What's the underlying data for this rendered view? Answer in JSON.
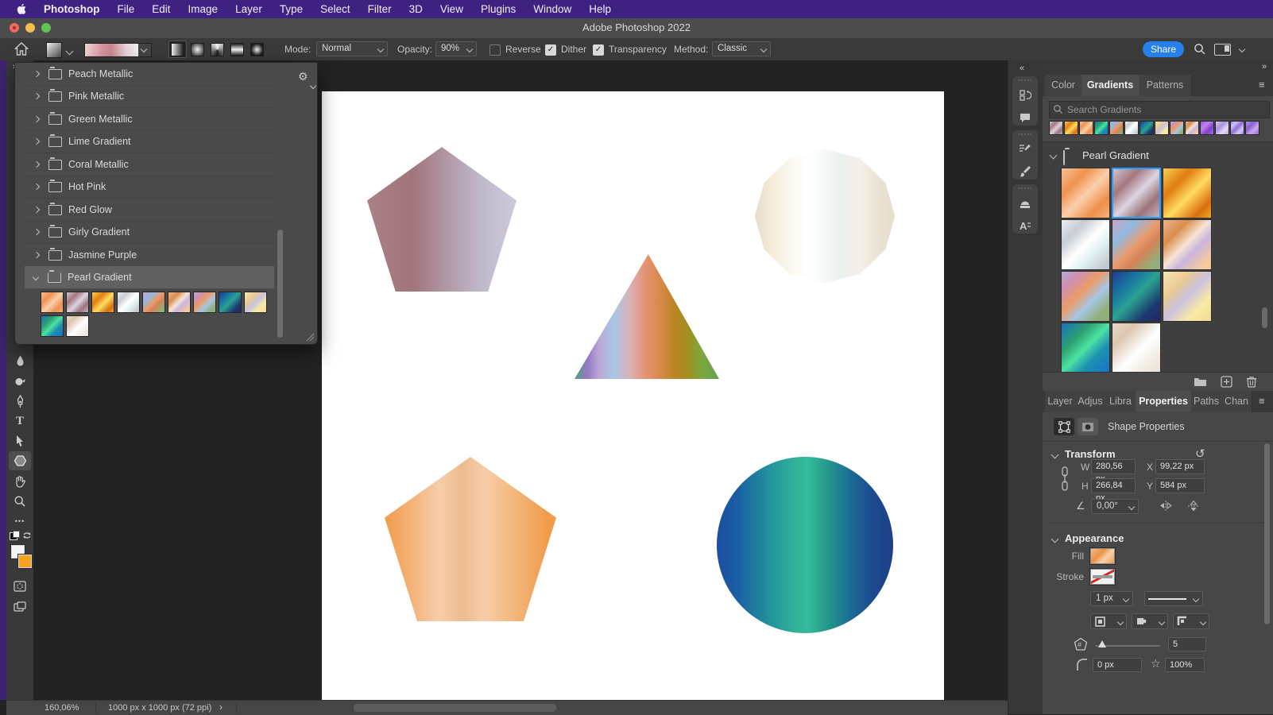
{
  "icons": {
    "gear": "⚙",
    "hamburger": "≡",
    "check": "✓",
    "star": "☆",
    "reset": "↺",
    "angle": "∠",
    "ellipsis": "•••",
    "collapse_left": "«",
    "collapse_right": "»",
    "chevron_right_small": "›"
  },
  "menu_bar": {
    "items": [
      "Photoshop",
      "File",
      "Edit",
      "Image",
      "Layer",
      "Type",
      "Select",
      "Filter",
      "3D",
      "View",
      "Plugins",
      "Window",
      "Help"
    ]
  },
  "title_bar": {
    "title": "Adobe Photoshop 2022"
  },
  "options_bar": {
    "mode_label": "Mode:",
    "mode_value": "Normal",
    "opacity_label": "Opacity:",
    "opacity_value": "90%",
    "reverse_label": "Reverse",
    "dither_label": "Dither",
    "transparency_label": "Transparency",
    "method_label": "Method:",
    "method_value": "Classic",
    "share_label": "Share",
    "gradient_preview": "linear-gradient(90deg,#eed2d5 0%,#d6959d 32%,#ca868f 48%,#e5d5dc 78%,#f3edf0 100%)"
  },
  "preset_popup": {
    "folders": [
      "Peach Metallic",
      "Pink Metallic",
      "Green Metallic",
      "Lime Gradient",
      "Coral Metallic",
      "Hot Pink",
      "Red Glow",
      "Girly Gradient",
      "Jasmine Purple"
    ],
    "selected_folder": "Pearl Gradient"
  },
  "pearl_swatches": [
    "linear-gradient(135deg,#f6c193 0%,#ef9250 28%,#f9d0ab 52%,#ee8f4c 78%,#f4b077 100%)",
    "linear-gradient(135deg,#cfc3d1 0%,#a5777e 28%,#dcd4e0 52%,#9c737b 76%,#c0b1bd 100%)",
    "linear-gradient(135deg,#f8cf52 0%,#e07d12 30%,#ffdb60 55%,#d96f0e 82%,#eda827 100%)",
    "linear-gradient(135deg,#eceff1 0%,#c6ccd2 25%,#ffffff 50%,#dff0f2 68%,#c2c8ce 92%)",
    "linear-gradient(135deg,#cba4c6 0%,#90b9e1 26%,#ea9a6c 50%,#d58457 64%,#90af79 88%)",
    "linear-gradient(135deg,#eab78e 0%,#da8c4c 26%,#f6e4d4 48%,#cab5dd 64%,#f6ca9c 88%)",
    "linear-gradient(135deg,#b6aad6 0%,#cf8fb0 20%,#ea9c66 42%,#a6c6e6 62%,#90b07a 84%)",
    "linear-gradient(135deg,#1b3b91 0%,#1b7ba1 30%,#2ba191 50%,#1b3b71 78%,#262661 100%)",
    "linear-gradient(135deg,#f7e6b6 0%,#eacb91 28%,#cbc1de 50%,#f7eaa6 74%,#f2db8c 100%)",
    "linear-gradient(135deg,#1b71c1 0%,#2ba171 30%,#4ce1a1 50%,#1b91b1 70%,#1b71c6 100%)",
    "linear-gradient(135deg,#e6d6c6 0%,#dbc6ae 24%,#ffffff 55%,#f2eae2 80%,#eadfd6 100%)"
  ],
  "gradients_panel": {
    "tabs": [
      "Color",
      "Gradients",
      "Patterns"
    ],
    "search_placeholder": "Search Gradients",
    "folder_name": "Pearl Gradient",
    "recent_swatches": [
      "linear-gradient(135deg,#cfc3d1 0%,#a5777e 28%,#dcd4e0 52%,#9c737b 76%,#c0b1bd 100%)",
      "linear-gradient(135deg,#f8cf52 0%,#e07d12 30%,#ffdb60 55%,#d96f0e 82%,#eda827 100%)",
      "linear-gradient(135deg,#f6c193 0%,#ef9250 28%,#f9d0ab 52%,#ee8f4c 78%,#f4b077 100%)",
      "linear-gradient(135deg,#1b71c1 0%,#2ba171 30%,#4ce1a1 50%,#1b91b1 70%,#1b71c6 100%)",
      "linear-gradient(135deg,#cba4c6 0%,#90b9e1 26%,#ea9a6c 50%,#d58457 64%,#90af79 88%)",
      "linear-gradient(135deg,#eceff1 0%,#c6ccd2 25%,#ffffff 50%,#dff0f2 68%,#c2c8ce 92%)",
      "linear-gradient(135deg,#1b3b91 0%,#1b7ba1 30%,#2ba191 50%,#1b3b71 78%,#262661 100%)",
      "linear-gradient(135deg,#f7e6b6 0%,#eacb91 28%,#cbc1de 50%,#f7eaa6 74%,#f2db8c 100%)",
      "linear-gradient(135deg,#b6aad6 0%,#cf8fb0 20%,#ea9c66 42%,#a6c6e6 62%,#90b07a 84%)",
      "linear-gradient(135deg,#eab78e 0%,#da8c4c 26%,#f6e4d4 48%,#cab5dd 64%,#f6ca9c 88%)",
      "linear-gradient(135deg,#9b59e0 0%,#c084f0 35%,#8040cc 65%,#ab6ae6 100%)",
      "linear-gradient(135deg,#d6c9f2 0%,#a893dc 38%,#e4d9f7 68%,#b5a5e6 100%)",
      "linear-gradient(135deg,#a07fe6 0%,#d2c2f6 22%,#8f6fd6 48%,#d8c8f7 74%,#9f7fe2 100%)",
      "linear-gradient(135deg,#b78fe9 0%,#8a5ed1 35%,#cbaaf1 65%,#9168d5 100%)"
    ]
  },
  "properties_panel": {
    "tabs": [
      "Layer",
      "Adjus",
      "Libra",
      "Properties",
      "Paths",
      "Chan"
    ],
    "header_label": "Shape Properties",
    "transform": {
      "title": "Transform",
      "w_label": "W",
      "w_value": "280,56 px",
      "x_label": "X",
      "x_value": "99,22 px",
      "h_label": "H",
      "h_value": "266,84 px",
      "y_label": "Y",
      "y_value": "584 px",
      "angle_value": "0,00°"
    },
    "appearance": {
      "title": "Appearance",
      "fill_label": "Fill",
      "stroke_label": "Stroke",
      "stroke_width_value": "1 px",
      "sides_value": "5",
      "corner_radius_value": "0 px",
      "star_ratio_value": "100%",
      "fill_swatch": "linear-gradient(135deg,#f6bd85 0%,#ea9048 38%,#f9d2a8 62%,#ef9c52 100%)"
    }
  },
  "status_bar": {
    "zoom_value": "160,06%",
    "doc_info": "1000 px x 1000 px (72 ppi)"
  },
  "canvas": {
    "shapes": [
      {
        "name": "pentagon-mauve",
        "fill": "linear-gradient(90deg,#ab8186 0%,#a1747b 30%,#b29aa8 55%,#bfb7ca 75%,#cdc9db 100%)"
      },
      {
        "name": "dodecagon-pearl",
        "fill": "linear-gradient(90deg,#e7dbc9 0%,#f4ecdc 14%,#fcf9f2 28%,#ffffff 40%,#f2f7f5 52%,#e9f1ee 62%,#f3f0e7 74%,#eae2d2 88%,#e6dccb 100%)"
      },
      {
        "name": "triangle-rainbow",
        "fill": "linear-gradient(90deg,#4f9f85 0%,#9678c2 9%,#b9a8d6 17%,#a9c6e6 27%,#d8b2b8 38%,#e69478 48%,#d98a4f 58%,#c08428 68%,#a08f1e 78%,#7aa83f 88%,#69a04d 100%)"
      },
      {
        "name": "pentagon-orange",
        "fill": "linear-gradient(90deg,#f09c4c 0%,#f3b277 15%,#f7cda8 32%,#edbb90 45%,#f6cda9 58%,#f3b87e 75%,#ef9c4b 95%)"
      },
      {
        "name": "circle-blue-teal",
        "fill": "linear-gradient(90deg,#1d4fa0 0%,#1a5fa4 12%,#22949b 30%,#31b298 45%,#35b99b 52%,#23988b 63%,#1b6f95 75%,#1c4a90 88%,#1d4088 100%)"
      }
    ]
  },
  "colors": {
    "accent_selection": "#2b9cff",
    "share_button": "#2680eb",
    "menubar": "#3e2181"
  }
}
